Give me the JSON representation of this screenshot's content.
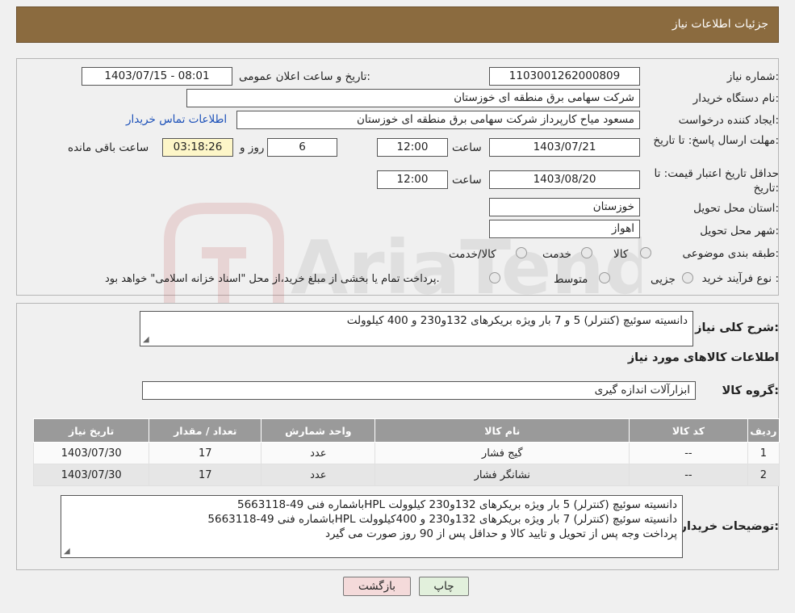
{
  "header": {
    "title": "جزئیات اطلاعات نیاز"
  },
  "form": {
    "need_number_label": "شماره نیاز:",
    "need_number": "1103001262000809",
    "announce_label": "تاریخ و ساعت اعلان عمومی:",
    "announce_value": "1403/07/15 - 08:01",
    "buyer_org_label": "نام دستگاه خریدار:",
    "buyer_org": "شرکت سهامی برق منطقه ای خوزستان",
    "creator_label": "ایجاد کننده درخواست:",
    "creator": "مسعود میاح کارپرداز شرکت سهامی برق منطقه ای خوزستان",
    "contact_link": "اطلاعات تماس خریدار",
    "reply_deadline_label": "مهلت ارسال پاسخ: تا تاریخ:",
    "reply_date": "1403/07/21",
    "time_label": "ساعت",
    "reply_time": "12:00",
    "days_value": "6",
    "days_label": "روز و",
    "remaining_value": "03:18:26",
    "remaining_label": "ساعت باقی مانده",
    "validity_label": "حداقل تاریخ اعتبار قیمت: تا تاریخ:",
    "validity_date": "1403/08/20",
    "validity_time": "12:00",
    "province_label": "استان محل تحویل:",
    "province": "خوزستان",
    "city_label": "شهر محل تحویل:",
    "city": "اهواز",
    "category_label": "طبقه بندی موضوعی:",
    "category_options": [
      "کالا",
      "خدمت",
      "کالا/خدمت"
    ],
    "purchase_type_label": "نوع فرآیند خرید :",
    "purchase_options": [
      "جزیی",
      "متوسط"
    ],
    "purchase_note": "پرداخت تمام یا بخشی از مبلغ خرید،از محل \"اسناد خزانه اسلامی\" خواهد بود."
  },
  "summary": {
    "description_label": "شرح کلی نیاز:",
    "description": "دانسیته سوئیچ (کنترلر) 5 و 7 بار ویژه بریکرهای 132و230 و 400 کیلوولت",
    "goods_info_title": "اطلاعات کالاهای مورد نیاز",
    "goods_group_label": "گروه کالا:",
    "goods_group": "ابزارآلات اندازه گیری"
  },
  "table": {
    "headers": [
      "ردیف",
      "کد کالا",
      "نام کالا",
      "واحد شمارش",
      "تعداد / مقدار",
      "تاریخ نیاز"
    ],
    "rows": [
      [
        "1",
        "--",
        "گیج فشار",
        "عدد",
        "17",
        "1403/07/30"
      ],
      [
        "2",
        "--",
        "نشانگر فشار",
        "عدد",
        "17",
        "1403/07/30"
      ]
    ]
  },
  "buyer_notes": {
    "label": "توضیحات خریدار:",
    "lines": [
      "دانسیته سوئیچ (کنترلر) 5 بار ویژه بریکرهای 132و230 کیلوولت HPLباشماره فنی 49-5663118",
      "دانسیته سوئیچ (کنترلر) 7 بار ویژه بریکرهای 132و230 و 400کیلوولت HPLباشماره فنی 49-5663118",
      "پرداخت وجه پس از تحویل و تایید کالا و حداقل پس از 90 روز صورت می گیرد"
    ]
  },
  "buttons": {
    "print": "چاپ",
    "back": "بازگشت"
  },
  "watermark": {
    "text": "AriaTender.neT"
  },
  "colors": {
    "header_bg": "#8b6b3f",
    "table_header": "#9a9a9a",
    "link": "#1a4fb8",
    "back_button": "#f4dada",
    "print_button": "#e2f0dc"
  }
}
